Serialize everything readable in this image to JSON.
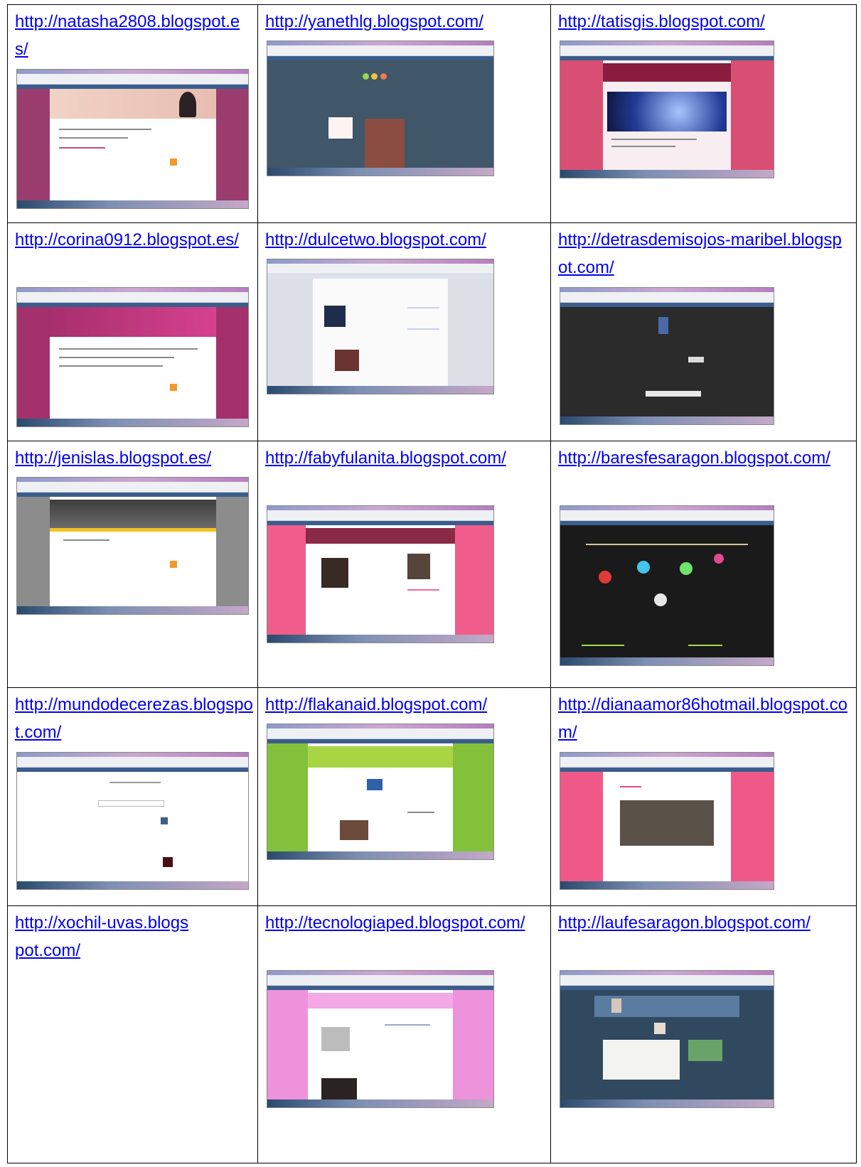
{
  "rows": [
    {
      "cells": [
        {
          "url": "http://natasha2808.blogspot.es/"
        },
        {
          "url": "http://yanethlg.blogspot.com/"
        },
        {
          "url": "http://tatisgis.blogspot.com/"
        }
      ]
    },
    {
      "cells": [
        {
          "url": "http://corina0912.blogspot.es/"
        },
        {
          "url": "http://dulcetwo.blogspot.com/"
        },
        {
          "url": "http://detrasdemisojos-maribel.blogspot.com/"
        }
      ]
    },
    {
      "cells": [
        {
          "url": "http://jenislas.blogspot.es/"
        },
        {
          "url": "http://fabyfulanita.blogspot.com/"
        },
        {
          "url": "http://baresfesaragon.blogspot.com/"
        }
      ]
    },
    {
      "cells": [
        {
          "url": "http://mundodecerezas.blogspot.com/"
        },
        {
          "url": "http://flakanaid.blogspot.com/"
        },
        {
          "url": "http://dianaamor86hotmail.blogspot.com/"
        }
      ]
    },
    {
      "cells": [
        {
          "url": "http://xochil-uvas.blogspot.com/"
        },
        {
          "url": "http://tecnologiaped.blogspot.com/"
        },
        {
          "url": "http://laufesaragon.blogspot.com/"
        }
      ]
    }
  ]
}
